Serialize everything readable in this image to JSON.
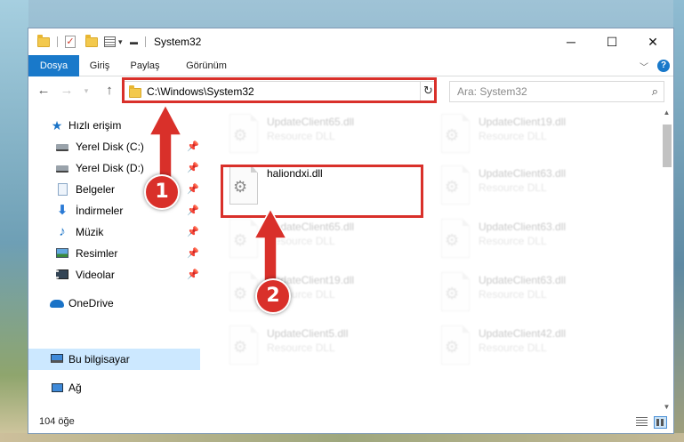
{
  "window": {
    "title": "System32",
    "minimize": "─",
    "maximize": "☐",
    "close": "✕"
  },
  "ribbon": {
    "tabs": [
      "Dosya",
      "Giriş",
      "Paylaş",
      "Görünüm"
    ],
    "help": "?"
  },
  "nav": {
    "address": "C:\\Windows\\System32",
    "search_placeholder": "Ara: System32"
  },
  "sidebar": {
    "items": [
      {
        "label": "Hızlı erişim",
        "icon": "star-icon",
        "pinned": false
      },
      {
        "label": "Yerel Disk (C:)",
        "icon": "drive-icon",
        "pinned": true
      },
      {
        "label": "Yerel Disk (D:)",
        "icon": "drive-icon",
        "pinned": true
      },
      {
        "label": "Belgeler",
        "icon": "documents-icon",
        "pinned": true
      },
      {
        "label": "İndirmeler",
        "icon": "download-icon",
        "pinned": true
      },
      {
        "label": "Müzik",
        "icon": "music-icon",
        "pinned": true
      },
      {
        "label": "Resimler",
        "icon": "pictures-icon",
        "pinned": true
      },
      {
        "label": "Videolar",
        "icon": "videos-icon",
        "pinned": true
      },
      {
        "label": "OneDrive",
        "icon": "cloud-icon",
        "pinned": false
      },
      {
        "label": "Bu bilgisayar",
        "icon": "computer-icon",
        "pinned": false,
        "selected": true
      },
      {
        "label": "Ağ",
        "icon": "network-icon",
        "pinned": false
      }
    ]
  },
  "files": [
    {
      "name": "UpdateClient65.dll",
      "type": "Resource DLL",
      "faded": true
    },
    {
      "name": "UpdateClient19.dll",
      "type": "Resource DLL",
      "faded": true
    },
    {
      "name": "haliondxi.dll",
      "type": "",
      "faded": false,
      "highlighted": true
    },
    {
      "name": "UpdateClient63.dll",
      "type": "Resource DLL",
      "faded": true
    },
    {
      "name": "UpdateClient65.dll",
      "type": "Resource DLL",
      "faded": true
    },
    {
      "name": "UpdateClient63.dll",
      "type": "Resource DLL",
      "faded": true
    },
    {
      "name": "UpdateClient19.dll",
      "type": "Resource DLL",
      "faded": true
    },
    {
      "name": "UpdateClient63.dll",
      "type": "Resource DLL",
      "faded": true
    },
    {
      "name": "UpdateClient5.dll",
      "type": "Resource DLL",
      "faded": true
    },
    {
      "name": "UpdateClient42.dll",
      "type": "Resource DLL",
      "faded": true
    }
  ],
  "status": {
    "item_count": "104 öğe"
  },
  "annotations": {
    "step1": "1",
    "step2": "2",
    "color": "#d9302a"
  }
}
